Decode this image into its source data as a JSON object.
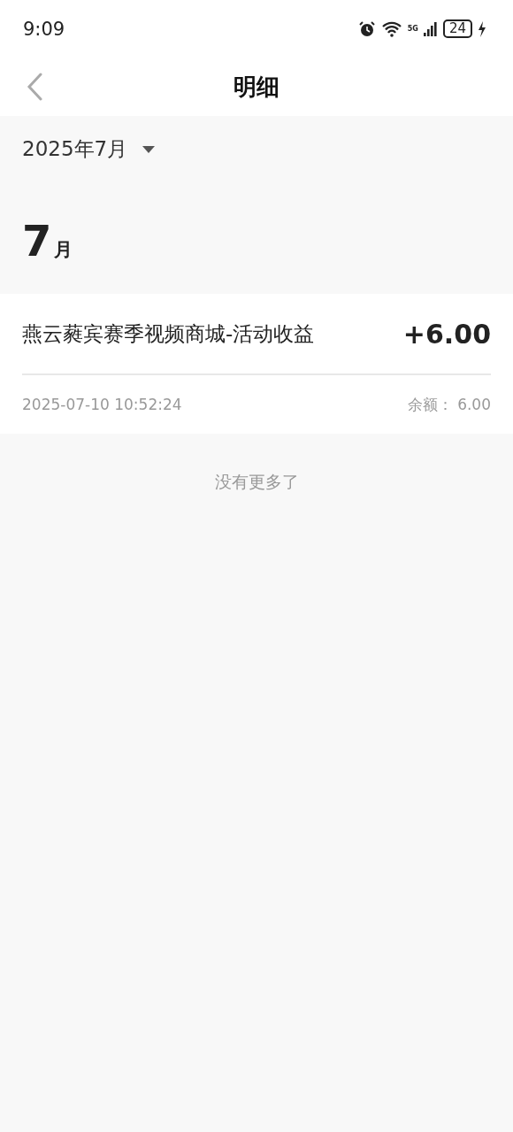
{
  "status_bar": {
    "time": "9:09",
    "network": "5G",
    "battery": "24",
    "charging": true
  },
  "header": {
    "title": "明细"
  },
  "month_picker": {
    "label": "2025年7月"
  },
  "month_group": {
    "number": "7",
    "unit": "月"
  },
  "transactions": [
    {
      "title": "燕云蕤宾赛季视频商城-活动收益",
      "amount": "+6.00",
      "time": "2025-07-10 10:52:24",
      "balance_label": "余额：",
      "balance": "6.00"
    }
  ],
  "footer": {
    "text": "没有更多了"
  }
}
